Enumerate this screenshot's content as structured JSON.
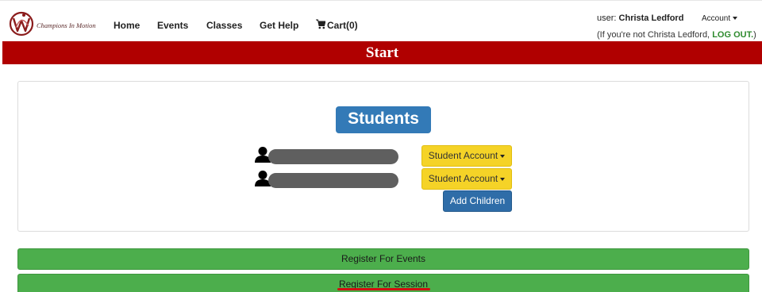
{
  "header": {
    "logo_text": "Champions In Motion",
    "nav": [
      {
        "label": "Home"
      },
      {
        "label": "Events"
      },
      {
        "label": "Classes"
      },
      {
        "label": "Get Help"
      }
    ],
    "cart_label": "Cart(0)",
    "user_prefix": "user:",
    "user_name": "Christa Ledford",
    "account_label": "Account",
    "notuser_prefix": "(If you're not Christa Ledford,",
    "logout_label": "LOG OUT.",
    "notuser_suffix": ")"
  },
  "banner": {
    "title": "Start"
  },
  "students": {
    "heading": "Students",
    "rows": [
      {
        "account_button": "Student Account"
      },
      {
        "account_button": "Student Account"
      }
    ],
    "add_children": "Add Children"
  },
  "actions": {
    "register_events": "Register For Events",
    "register_session": "Register For Session"
  },
  "colors": {
    "banner": "#b00000",
    "students_badge": "#337ab7",
    "student_account_button": "#f5d327",
    "add_children_button": "#2f6da8",
    "register_buttons": "#4cae4c",
    "logout_link": "#2e8a2e"
  },
  "icons": [
    "logo-emblem",
    "cart-icon",
    "person-icon",
    "chevron-down-icon"
  ]
}
